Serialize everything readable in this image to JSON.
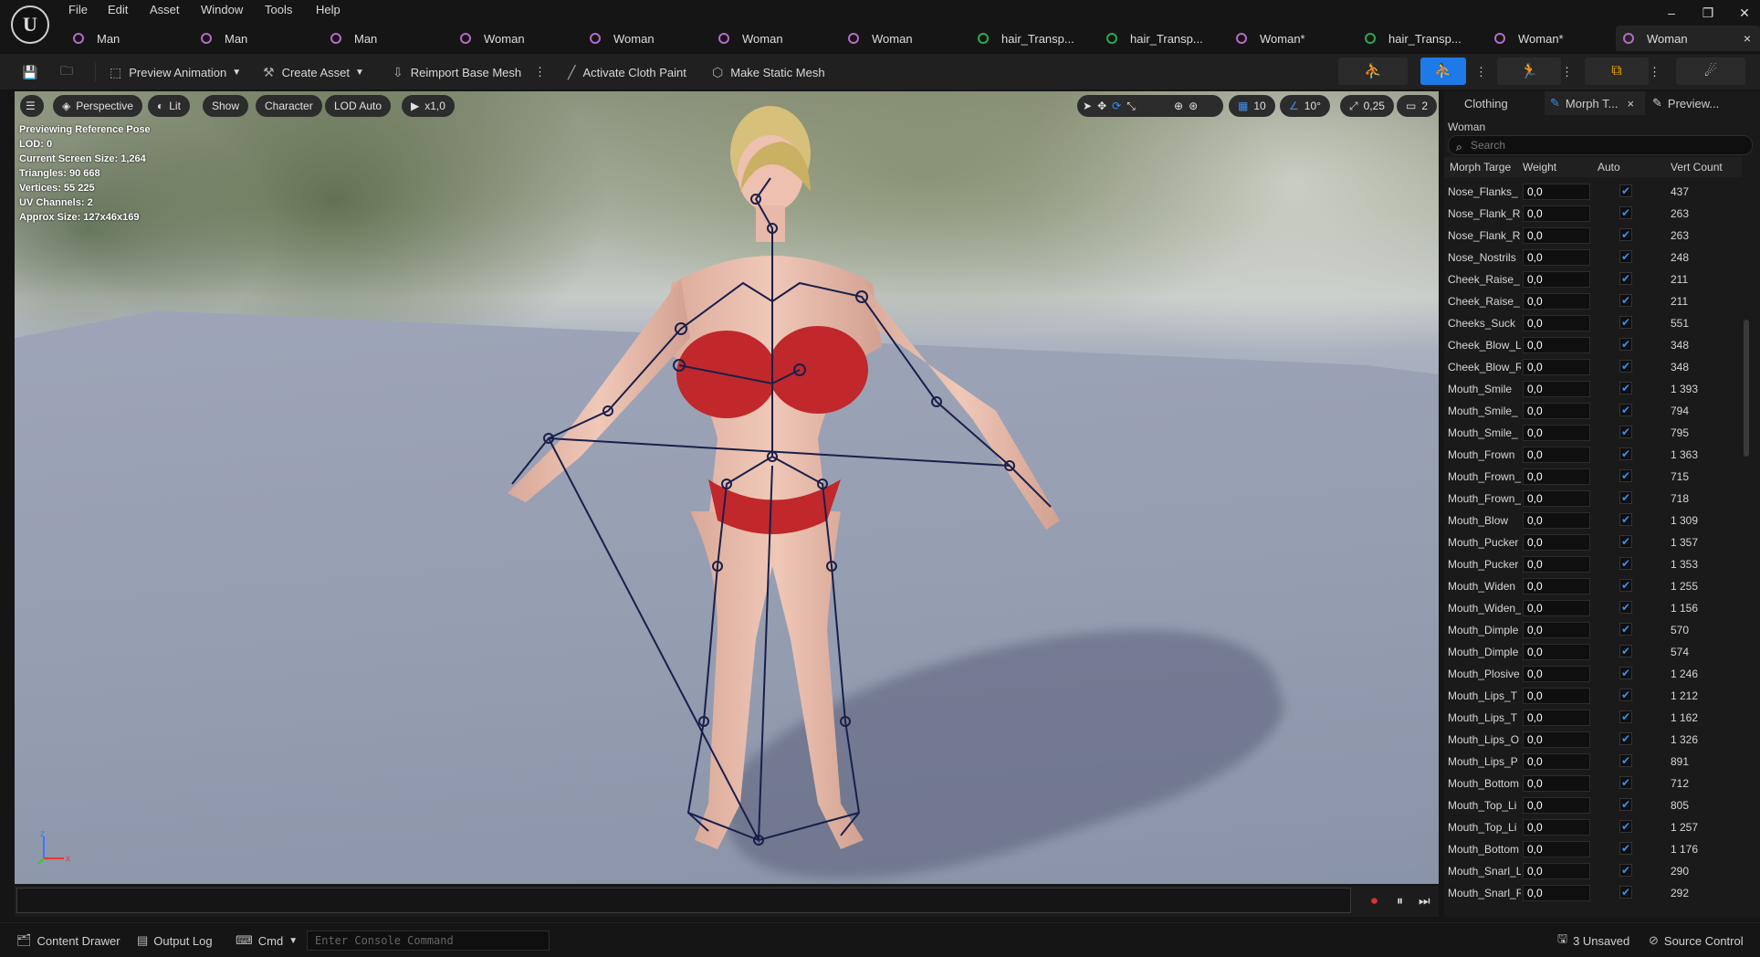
{
  "menu": {
    "items": [
      "File",
      "Edit",
      "Asset",
      "Window",
      "Tools",
      "Help"
    ],
    "logo": "U"
  },
  "window_controls": {
    "minimize": "–",
    "restore": "❐",
    "close": "✕"
  },
  "tabs": [
    {
      "label": "Man",
      "icon": "skeletal-mesh-icon"
    },
    {
      "label": "Man",
      "icon": "skeletal-mesh-icon"
    },
    {
      "label": "Man",
      "icon": "skeletal-mesh-icon"
    },
    {
      "label": "Woman",
      "icon": "skeletal-mesh-icon"
    },
    {
      "label": "Woman",
      "icon": "skeletal-mesh-icon"
    },
    {
      "label": "Woman",
      "icon": "skeletal-mesh-icon"
    },
    {
      "label": "Woman",
      "icon": "skeletal-mesh-icon"
    },
    {
      "label": "hair_Transp...",
      "icon": "groom-icon"
    },
    {
      "label": "hair_Transp...",
      "icon": "groom-icon"
    },
    {
      "label": "Woman*",
      "icon": "skeletal-mesh-icon"
    },
    {
      "label": "hair_Transp...",
      "icon": "groom-icon"
    },
    {
      "label": "Woman*",
      "icon": "skeletal-mesh-icon"
    },
    {
      "label": "Woman",
      "icon": "skeletal-mesh-icon",
      "active": true,
      "close": "×"
    }
  ],
  "toolbar": {
    "preview_animation": "Preview Animation",
    "create_asset": "Create Asset",
    "reimport": "Reimport Base Mesh",
    "cloth_paint": "Activate Cloth Paint",
    "static_mesh": "Make Static Mesh"
  },
  "viewport": {
    "perspective": "Perspective",
    "lit": "Lit",
    "show": "Show",
    "character": "Character",
    "lod": "LOD Auto",
    "speed": "x1,0",
    "grid_snap": "10",
    "angle_snap": "10°",
    "scale_snap": "0,25",
    "camera_speed": "2",
    "info": [
      "Previewing Reference Pose",
      "LOD: 0",
      "Current Screen Size: 1,264",
      "Triangles: 90 668",
      "Vertices: 55 225",
      "UV Channels: 2",
      "Approx Size: 127x46x169"
    ],
    "axis": {
      "x": "x",
      "z": "z"
    }
  },
  "panel": {
    "tabs": [
      "Clothing",
      "Morph T...",
      "Preview..."
    ],
    "tab_close": "×",
    "title": "Woman",
    "search_placeholder": "Search",
    "columns": [
      "Morph Targe",
      "Weight",
      "Auto",
      "Vert Count"
    ],
    "rows": [
      {
        "name": "Nose_Flanks_",
        "weight": "0,0",
        "auto": true,
        "count": "437"
      },
      {
        "name": "Nose_Flank_R",
        "weight": "0,0",
        "auto": true,
        "count": "263"
      },
      {
        "name": "Nose_Flank_R",
        "weight": "0,0",
        "auto": true,
        "count": "263"
      },
      {
        "name": "Nose_Nostrils",
        "weight": "0,0",
        "auto": true,
        "count": "248"
      },
      {
        "name": "Cheek_Raise_",
        "weight": "0,0",
        "auto": true,
        "count": "211"
      },
      {
        "name": "Cheek_Raise_",
        "weight": "0,0",
        "auto": true,
        "count": "211"
      },
      {
        "name": "Cheeks_Suck",
        "weight": "0,0",
        "auto": true,
        "count": "551"
      },
      {
        "name": "Cheek_Blow_L",
        "weight": "0,0",
        "auto": true,
        "count": "348"
      },
      {
        "name": "Cheek_Blow_R",
        "weight": "0,0",
        "auto": true,
        "count": "348"
      },
      {
        "name": "Mouth_Smile",
        "weight": "0,0",
        "auto": true,
        "count": "1 393"
      },
      {
        "name": "Mouth_Smile_",
        "weight": "0,0",
        "auto": true,
        "count": "794"
      },
      {
        "name": "Mouth_Smile_",
        "weight": "0,0",
        "auto": true,
        "count": "795"
      },
      {
        "name": "Mouth_Frown",
        "weight": "0,0",
        "auto": true,
        "count": "1 363"
      },
      {
        "name": "Mouth_Frown_",
        "weight": "0,0",
        "auto": true,
        "count": "715"
      },
      {
        "name": "Mouth_Frown_",
        "weight": "0,0",
        "auto": true,
        "count": "718"
      },
      {
        "name": "Mouth_Blow",
        "weight": "0,0",
        "auto": true,
        "count": "1 309"
      },
      {
        "name": "Mouth_Pucker",
        "weight": "0,0",
        "auto": true,
        "count": "1 357"
      },
      {
        "name": "Mouth_Pucker",
        "weight": "0,0",
        "auto": true,
        "count": "1 353"
      },
      {
        "name": "Mouth_Widen",
        "weight": "0,0",
        "auto": true,
        "count": "1 255"
      },
      {
        "name": "Mouth_Widen_",
        "weight": "0,0",
        "auto": true,
        "count": "1 156"
      },
      {
        "name": "Mouth_Dimple",
        "weight": "0,0",
        "auto": true,
        "count": "570"
      },
      {
        "name": "Mouth_Dimple",
        "weight": "0,0",
        "auto": true,
        "count": "574"
      },
      {
        "name": "Mouth_Plosive",
        "weight": "0,0",
        "auto": true,
        "count": "1 246"
      },
      {
        "name": "Mouth_Lips_T",
        "weight": "0,0",
        "auto": true,
        "count": "1 212"
      },
      {
        "name": "Mouth_Lips_T",
        "weight": "0,0",
        "auto": true,
        "count": "1 162"
      },
      {
        "name": "Mouth_Lips_O",
        "weight": "0,0",
        "auto": true,
        "count": "1 326"
      },
      {
        "name": "Mouth_Lips_P",
        "weight": "0,0",
        "auto": true,
        "count": "891"
      },
      {
        "name": "Mouth_Bottom",
        "weight": "0,0",
        "auto": true,
        "count": "712"
      },
      {
        "name": "Mouth_Top_Li",
        "weight": "0,0",
        "auto": true,
        "count": "805"
      },
      {
        "name": "Mouth_Top_Li",
        "weight": "0,0",
        "auto": true,
        "count": "1 257"
      },
      {
        "name": "Mouth_Bottom",
        "weight": "0,0",
        "auto": true,
        "count": "1 176"
      },
      {
        "name": "Mouth_Snarl_L",
        "weight": "0,0",
        "auto": true,
        "count": "290"
      },
      {
        "name": "Mouth_Snarl_R",
        "weight": "0,0",
        "auto": true,
        "count": "292"
      }
    ]
  },
  "status": {
    "content_drawer": "Content Drawer",
    "output_log": "Output Log",
    "cmd": "Cmd",
    "console_placeholder": "Enter Console Command",
    "unsaved": "3 Unsaved",
    "source_control": "Source Control"
  },
  "colors": {
    "accent": "#1e7ae6",
    "bikini": "#c0282c",
    "skeleton": "#1a1f4a"
  }
}
